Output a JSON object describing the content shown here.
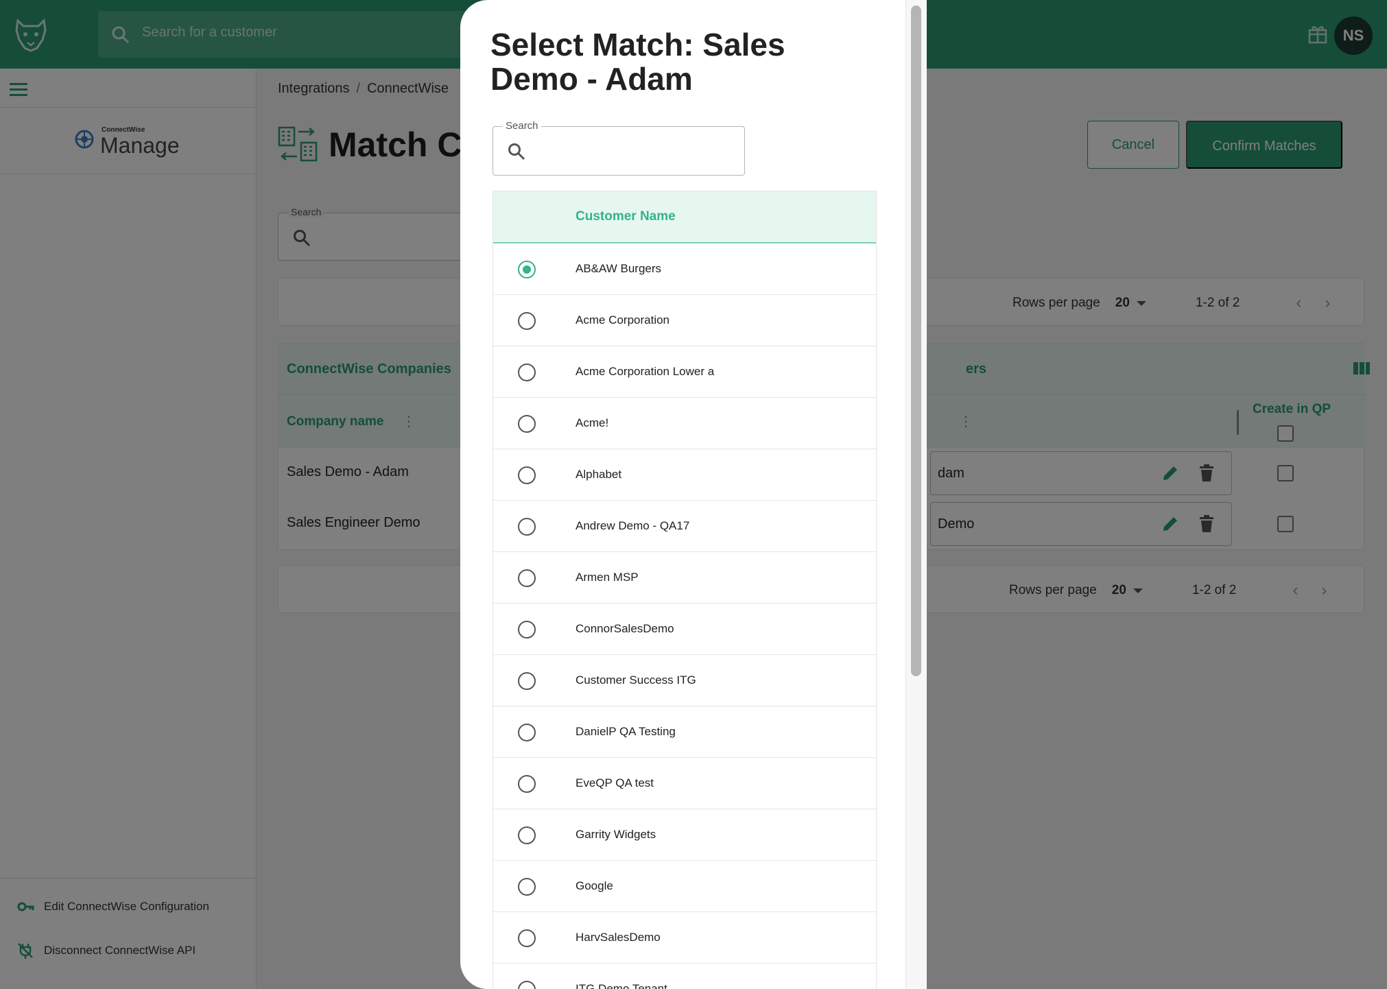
{
  "header": {
    "search_placeholder": "Search for a customer",
    "avatar_initials": "NS",
    "brand_color": "#2a9a72"
  },
  "sidebar": {
    "logo_small": "ConnectWise",
    "logo_main": "Manage",
    "links": [
      {
        "label": "Edit ConnectWise Configuration",
        "icon": "key-icon"
      },
      {
        "label": "Disconnect ConnectWise API",
        "icon": "plug-off-icon"
      }
    ]
  },
  "main": {
    "breadcrumb": [
      "Integrations",
      "ConnectWise"
    ],
    "title": "Match Cu",
    "cancel_label": "Cancel",
    "confirm_label": "Confirm Matches",
    "search_label": "Search",
    "pager": {
      "rows_per_page_label": "Rows per page",
      "rows_per_page": "20",
      "range": "1-2 of 2"
    },
    "table": {
      "left_group": "ConnectWise Companies",
      "right_group": "ers",
      "col_company": "Company name",
      "col_create": "Create in QP",
      "rows": [
        {
          "company": "Sales Demo - Adam",
          "match": "dam"
        },
        {
          "company": "Sales Engineer Demo",
          "match": "Demo"
        }
      ]
    }
  },
  "modal": {
    "title": "Select Match: Sales Demo - Adam",
    "search_label": "Search",
    "column_header": "Customer Name",
    "selected_index": 0,
    "customers": [
      "AB&AW Burgers",
      "Acme Corporation",
      "Acme Corporation Lower a",
      "Acme!",
      "Alphabet",
      "Andrew Demo - QA17",
      "Armen MSP",
      "ConnorSalesDemo",
      "Customer Success ITG",
      "DanielP QA Testing",
      "EveQP QA test",
      "Garrity Widgets",
      "Google",
      "HarvSalesDemo",
      "ITG Demo Tenant"
    ]
  }
}
